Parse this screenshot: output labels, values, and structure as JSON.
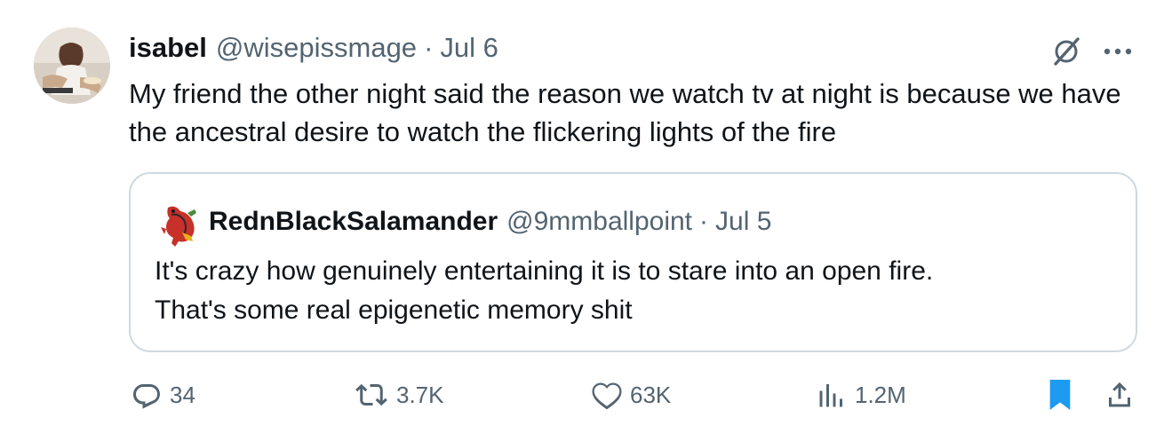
{
  "tweet": {
    "author_name": "isabel",
    "author_handle": "@wisepissmage",
    "separator": "·",
    "date": "Jul 6",
    "text": "My friend the other night said the reason we watch tv at night is because we have the ancestral desire to watch the flickering lights of the fire"
  },
  "quoted_tweet": {
    "author_name": "RednBlackSalamander",
    "author_handle": "@9mmballpoint",
    "separator": "·",
    "date": "Jul 5",
    "text_line1": "It's crazy how genuinely entertaining it is to stare into an open fire.",
    "text_line2": "That's some real epigenetic memory shit"
  },
  "actions": {
    "replies": "34",
    "retweets": "3.7K",
    "likes": "63K",
    "views": "1.2M",
    "bookmarked": true
  },
  "icons": {
    "reply": "reply-icon",
    "retweet": "retweet-icon",
    "like": "heart-icon",
    "views": "views-icon",
    "bookmark": "bookmark-icon",
    "share": "share-icon",
    "grok": "grok-icon",
    "more": "more-icon"
  },
  "colors": {
    "text_primary": "#0f1419",
    "text_secondary": "#536471",
    "border": "#cfd9de",
    "accent": "#1d9bf0"
  }
}
